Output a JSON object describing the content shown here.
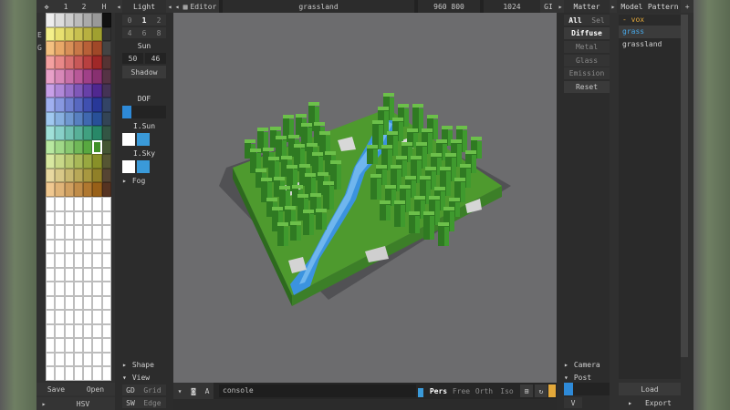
{
  "palette_panel": {
    "tabs": [
      "1",
      "2",
      "H"
    ],
    "side_letters": [
      "E",
      "G"
    ],
    "footer": {
      "save": "Save",
      "open": "Open",
      "mode": "HSV"
    }
  },
  "light_panel": {
    "title": "Light",
    "numbers_row1": [
      "0",
      "1",
      "2"
    ],
    "numbers_row2": [
      "4",
      "6",
      "8"
    ],
    "sun_label": "Sun",
    "sun_values": [
      "50",
      "46"
    ],
    "shadow": "Shadow",
    "dof": "DOF",
    "i_sun": "I.Sun",
    "i_sky": "I.Sky",
    "fog": "Fog",
    "shape": "Shape",
    "view": "View",
    "gd": "GD",
    "grid": "Grid",
    "sw": "SW",
    "edge": "Edge"
  },
  "editor": {
    "tab": "Editor",
    "doc_name": "grassland",
    "size": "960 800",
    "res": "1024",
    "gi": "GI",
    "console_placeholder": "console",
    "a_label": "A",
    "view_modes": [
      "Pers",
      "Free",
      "Orth",
      "Iso"
    ]
  },
  "matter_panel": {
    "title": "Matter",
    "tabs": [
      "All",
      "Sel"
    ],
    "items": [
      "Diffuse",
      "Metal",
      "Glass",
      "Emission"
    ],
    "reset": "Reset",
    "camera": "Camera",
    "post": "Post",
    "v": "V"
  },
  "model_panel": {
    "tabs": [
      "Model",
      "Pattern"
    ],
    "tree": [
      "- vox",
      "grass",
      "grassland"
    ],
    "load": "Load",
    "export": "Export"
  },
  "colors": {
    "accent_orange": "#e3a83a",
    "accent_blue": "#2e8ad8",
    "selected_text": "#48a8e8"
  }
}
